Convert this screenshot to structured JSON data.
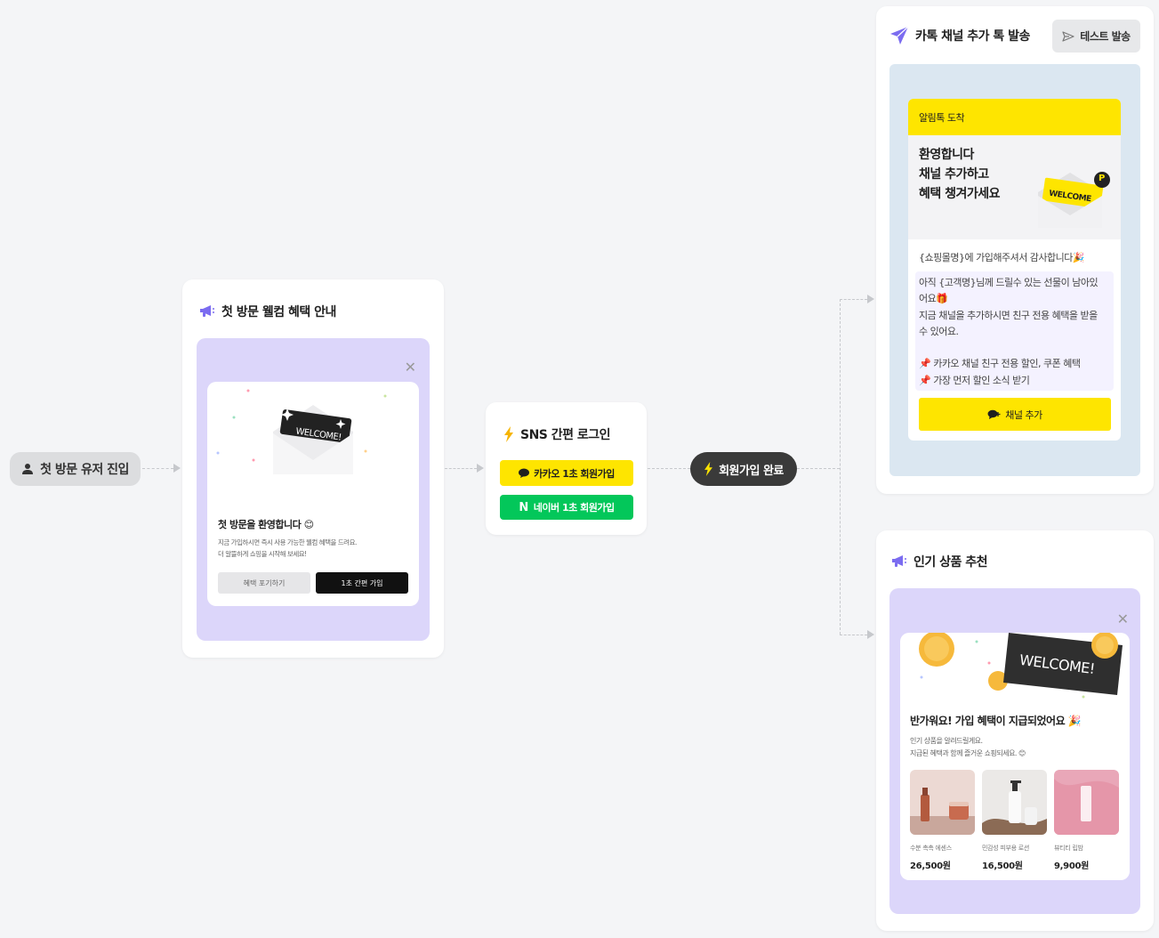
{
  "colors": {
    "background": "#f4f5f7",
    "purple_accent": "#7b6cf0",
    "purple_panel": "#dcd6fa",
    "kakao_yellow": "#fee500",
    "naver_green": "#03c75a",
    "blue_panel": "#dbe7f1",
    "dark_pill": "#3a3a3a"
  },
  "entry": {
    "label": "첫 방문 유저 진입",
    "icon": "user-icon"
  },
  "welcome_card": {
    "title": "첫 방문 웰컴 혜택 안내",
    "icon": "megaphone-icon",
    "ticket_text": "WELCOME!",
    "headline": "첫 방문을 환영합니다",
    "body_line1": "지금 가입하시면 즉시 사용 가능한 웰컴 혜택을 드려요.",
    "body_line2": "더 알뜰하게 쇼핑을 시작해 보세요!",
    "skip_button": "혜택 포기하기",
    "join_button": "1초 간편 가입"
  },
  "sns_card": {
    "title": "SNS 간편 로그인",
    "icon": "lightning-icon",
    "kakao_button": "카카오 1초 회원가입",
    "naver_button": "네이버 1초 회원가입",
    "naver_letter": "N"
  },
  "signup_done": {
    "label": "회원가입 완료",
    "icon": "lightning-icon"
  },
  "kakao_card": {
    "title": "카톡 채널 추가 톡 발송",
    "icon": "paper-plane-icon",
    "test_button": "테스트 발송",
    "msg_header": "알림톡 도착",
    "hero_title": "환영합니다\n채널 추가하고\n혜택 챙겨가세요",
    "hero_ticket": "WELCOME",
    "hero_badge": "P",
    "line1": "{쇼핑몰명}에 가입해주셔서 감사합니다🎉",
    "line2": "아직 {고객명}님께 드릴수 있는 선물이 남아있",
    "line3": "어요🎁",
    "line4": "지금 채널을 추가하시면 친구 전용 혜택을 받을",
    "line5": "수 있어요.",
    "line6": "📌 카카오 채널 친구 전용 할인, 쿠폰 혜택",
    "line7": "📌 가장 먼저 할인 소식 받기",
    "add_button": "채널 추가"
  },
  "product_card": {
    "title": "인기 상품 추천",
    "icon": "megaphone-icon",
    "ticket_text": "WELCOME!",
    "headline": "반가워요! 가입 혜택이 지급되었어요 🎉",
    "body_line1": "인기 상품을 알려드릴게요.",
    "body_line2": "지급된 혜택과 함께 즐거운 쇼핑되세요. 😊",
    "products": [
      {
        "name": "수분 촉촉 에센스",
        "price": "26,500원"
      },
      {
        "name": "민감성 피부용 로션",
        "price": "16,500원"
      },
      {
        "name": "뷰티티 립밤",
        "price": "9,900원"
      }
    ]
  }
}
